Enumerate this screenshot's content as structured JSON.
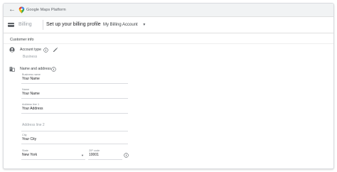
{
  "header": {
    "brand": "Google Maps Platform"
  },
  "subheader": {
    "section": "Billing",
    "title": "Set up your billing profile",
    "account_selector": "My Billing Account"
  },
  "customer_info": {
    "heading": "Customer info",
    "account_type": {
      "label": "Account type",
      "value": "Business"
    },
    "name_address": {
      "label": "Name and address"
    }
  },
  "form": {
    "business_name": {
      "label": "Business name",
      "value": "Your Name"
    },
    "name": {
      "label": "Name",
      "value": "Your Name"
    },
    "address_line_1": {
      "label": "Address line 1",
      "value": "Your Address"
    },
    "address_line_2": {
      "placeholder": "Address line 2"
    },
    "city": {
      "label": "City",
      "value": "Your City"
    },
    "state": {
      "label": "State",
      "value": "New York"
    },
    "zip": {
      "label": "ZIP code",
      "value": "10001"
    }
  },
  "colors": {
    "maps_pin_red": "#ea4335",
    "maps_pin_green": "#34a853",
    "maps_pin_yellow": "#fbbc04",
    "maps_pin_blue": "#4285f4"
  }
}
